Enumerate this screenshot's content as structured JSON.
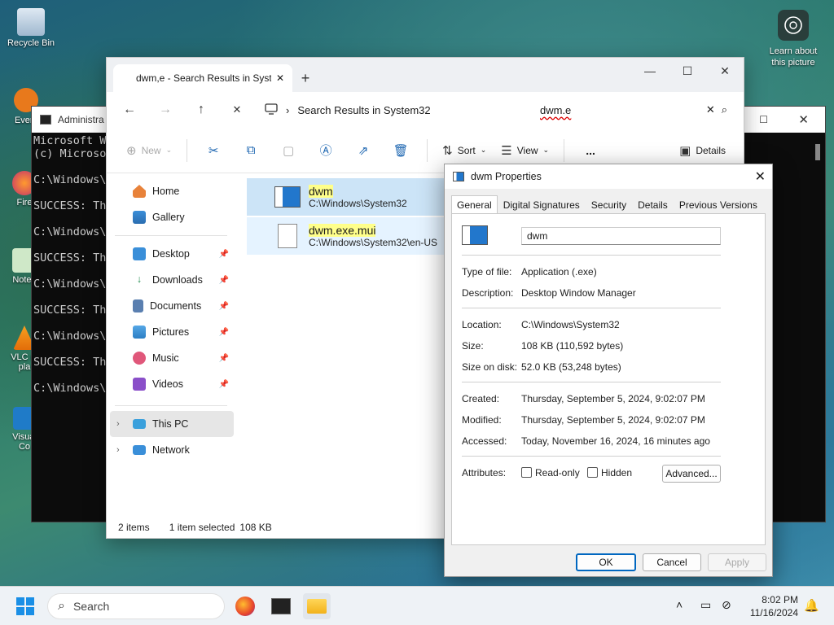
{
  "desktop": {
    "icons": [
      {
        "label": "Recycle Bin"
      },
      {
        "label": "Every"
      },
      {
        "label": "Fire"
      },
      {
        "label": "Notep"
      },
      {
        "label": "VLC m\npla"
      },
      {
        "label": "Visual\nCo"
      }
    ],
    "learn_label": "Learn about\nthis picture"
  },
  "cmd": {
    "title": "Administra",
    "lines": "Microsoft Wi\n(c) Microsof\n\nC:\\Windows\\S\n\nSUCCESS: The\n\nC:\\Windows\\S\n\nSUCCESS: The\n\nC:\\Windows\\S\n\nSUCCESS: The\n\nC:\\Windows\\S\n\nSUCCESS: The\n\nC:\\Windows\\S"
  },
  "explorer": {
    "tab_title": "dwm,e - Search Results in Syste",
    "breadcrumb": "Search Results in System32",
    "search_query": "dwm.e",
    "commands": {
      "new": "New",
      "sort": "Sort",
      "view": "View",
      "more": "...",
      "details": "Details"
    },
    "nav": {
      "home": "Home",
      "gallery": "Gallery",
      "desktop": "Desktop",
      "downloads": "Downloads",
      "documents": "Documents",
      "pictures": "Pictures",
      "music": "Music",
      "videos": "Videos",
      "this_pc": "This PC",
      "network": "Network"
    },
    "files": [
      {
        "name": "dwm",
        "path": "C:\\Windows\\System32"
      },
      {
        "name": "dwm.exe.mui",
        "path": "C:\\Windows\\System32\\en-US"
      }
    ],
    "status": {
      "items": "2 items",
      "selected": "1 item selected",
      "size": "108 KB"
    }
  },
  "props": {
    "title": "dwm Properties",
    "tabs": [
      "General",
      "Digital Signatures",
      "Security",
      "Details",
      "Previous Versions"
    ],
    "name_value": "dwm",
    "type_label": "Type of file:",
    "type_value": "Application (.exe)",
    "desc_label": "Description:",
    "desc_value": "Desktop Window Manager",
    "location_label": "Location:",
    "location_value": "C:\\Windows\\System32",
    "size_label": "Size:",
    "size_value": "108 KB (110,592 bytes)",
    "sizedisk_label": "Size on disk:",
    "sizedisk_value": "52.0 KB (53,248 bytes)",
    "created_label": "Created:",
    "created_value": "Thursday, September 5, 2024, 9:02:07 PM",
    "modified_label": "Modified:",
    "modified_value": "Thursday, September 5, 2024, 9:02:07 PM",
    "accessed_label": "Accessed:",
    "accessed_value": "Today, November 16, 2024, 16 minutes ago",
    "attr_label": "Attributes:",
    "readonly_label": "Read-only",
    "hidden_label": "Hidden",
    "advanced_label": "Advanced...",
    "ok": "OK",
    "cancel": "Cancel",
    "apply": "Apply"
  },
  "taskbar": {
    "search_label": "Search",
    "time": "8:02 PM",
    "date": "11/16/2024"
  }
}
